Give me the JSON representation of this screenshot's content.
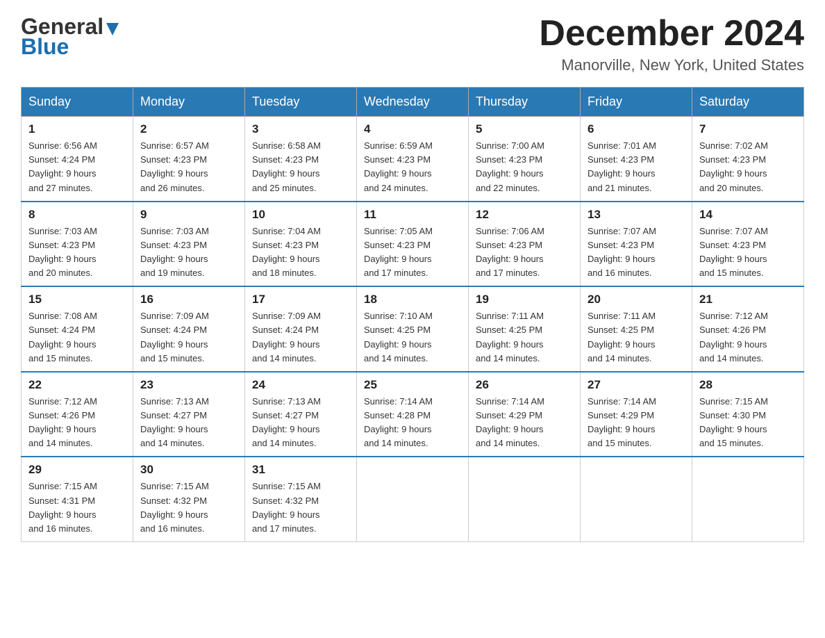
{
  "header": {
    "logo_general": "General",
    "logo_blue": "Blue",
    "month_title": "December 2024",
    "location": "Manorville, New York, United States"
  },
  "days_of_week": [
    "Sunday",
    "Monday",
    "Tuesday",
    "Wednesday",
    "Thursday",
    "Friday",
    "Saturday"
  ],
  "weeks": [
    [
      {
        "day": "1",
        "sunrise": "6:56 AM",
        "sunset": "4:24 PM",
        "daylight": "9 hours and 27 minutes."
      },
      {
        "day": "2",
        "sunrise": "6:57 AM",
        "sunset": "4:23 PM",
        "daylight": "9 hours and 26 minutes."
      },
      {
        "day": "3",
        "sunrise": "6:58 AM",
        "sunset": "4:23 PM",
        "daylight": "9 hours and 25 minutes."
      },
      {
        "day": "4",
        "sunrise": "6:59 AM",
        "sunset": "4:23 PM",
        "daylight": "9 hours and 24 minutes."
      },
      {
        "day": "5",
        "sunrise": "7:00 AM",
        "sunset": "4:23 PM",
        "daylight": "9 hours and 22 minutes."
      },
      {
        "day": "6",
        "sunrise": "7:01 AM",
        "sunset": "4:23 PM",
        "daylight": "9 hours and 21 minutes."
      },
      {
        "day": "7",
        "sunrise": "7:02 AM",
        "sunset": "4:23 PM",
        "daylight": "9 hours and 20 minutes."
      }
    ],
    [
      {
        "day": "8",
        "sunrise": "7:03 AM",
        "sunset": "4:23 PM",
        "daylight": "9 hours and 20 minutes."
      },
      {
        "day": "9",
        "sunrise": "7:03 AM",
        "sunset": "4:23 PM",
        "daylight": "9 hours and 19 minutes."
      },
      {
        "day": "10",
        "sunrise": "7:04 AM",
        "sunset": "4:23 PM",
        "daylight": "9 hours and 18 minutes."
      },
      {
        "day": "11",
        "sunrise": "7:05 AM",
        "sunset": "4:23 PM",
        "daylight": "9 hours and 17 minutes."
      },
      {
        "day": "12",
        "sunrise": "7:06 AM",
        "sunset": "4:23 PM",
        "daylight": "9 hours and 17 minutes."
      },
      {
        "day": "13",
        "sunrise": "7:07 AM",
        "sunset": "4:23 PM",
        "daylight": "9 hours and 16 minutes."
      },
      {
        "day": "14",
        "sunrise": "7:07 AM",
        "sunset": "4:23 PM",
        "daylight": "9 hours and 15 minutes."
      }
    ],
    [
      {
        "day": "15",
        "sunrise": "7:08 AM",
        "sunset": "4:24 PM",
        "daylight": "9 hours and 15 minutes."
      },
      {
        "day": "16",
        "sunrise": "7:09 AM",
        "sunset": "4:24 PM",
        "daylight": "9 hours and 15 minutes."
      },
      {
        "day": "17",
        "sunrise": "7:09 AM",
        "sunset": "4:24 PM",
        "daylight": "9 hours and 14 minutes."
      },
      {
        "day": "18",
        "sunrise": "7:10 AM",
        "sunset": "4:25 PM",
        "daylight": "9 hours and 14 minutes."
      },
      {
        "day": "19",
        "sunrise": "7:11 AM",
        "sunset": "4:25 PM",
        "daylight": "9 hours and 14 minutes."
      },
      {
        "day": "20",
        "sunrise": "7:11 AM",
        "sunset": "4:25 PM",
        "daylight": "9 hours and 14 minutes."
      },
      {
        "day": "21",
        "sunrise": "7:12 AM",
        "sunset": "4:26 PM",
        "daylight": "9 hours and 14 minutes."
      }
    ],
    [
      {
        "day": "22",
        "sunrise": "7:12 AM",
        "sunset": "4:26 PM",
        "daylight": "9 hours and 14 minutes."
      },
      {
        "day": "23",
        "sunrise": "7:13 AM",
        "sunset": "4:27 PM",
        "daylight": "9 hours and 14 minutes."
      },
      {
        "day": "24",
        "sunrise": "7:13 AM",
        "sunset": "4:27 PM",
        "daylight": "9 hours and 14 minutes."
      },
      {
        "day": "25",
        "sunrise": "7:14 AM",
        "sunset": "4:28 PM",
        "daylight": "9 hours and 14 minutes."
      },
      {
        "day": "26",
        "sunrise": "7:14 AM",
        "sunset": "4:29 PM",
        "daylight": "9 hours and 14 minutes."
      },
      {
        "day": "27",
        "sunrise": "7:14 AM",
        "sunset": "4:29 PM",
        "daylight": "9 hours and 15 minutes."
      },
      {
        "day": "28",
        "sunrise": "7:15 AM",
        "sunset": "4:30 PM",
        "daylight": "9 hours and 15 minutes."
      }
    ],
    [
      {
        "day": "29",
        "sunrise": "7:15 AM",
        "sunset": "4:31 PM",
        "daylight": "9 hours and 16 minutes."
      },
      {
        "day": "30",
        "sunrise": "7:15 AM",
        "sunset": "4:32 PM",
        "daylight": "9 hours and 16 minutes."
      },
      {
        "day": "31",
        "sunrise": "7:15 AM",
        "sunset": "4:32 PM",
        "daylight": "9 hours and 17 minutes."
      },
      null,
      null,
      null,
      null
    ]
  ],
  "labels": {
    "sunrise": "Sunrise:",
    "sunset": "Sunset:",
    "daylight": "Daylight:"
  }
}
